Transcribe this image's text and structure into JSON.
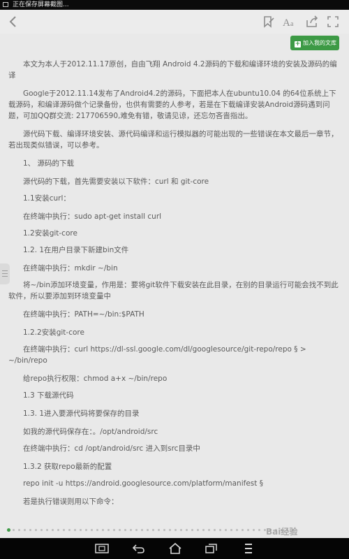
{
  "status_bar": {
    "text": "正在保存屏幕截图..."
  },
  "toolbar": {
    "back_icon": "back-chevron-icon",
    "tools": [
      "bookmark-edit-icon",
      "font-size-icon",
      "share-icon",
      "fullscreen-icon"
    ]
  },
  "add_library_button": {
    "label": "加入我的文库"
  },
  "article": {
    "paragraphs": [
      {
        "text": "本文为本人于2012.11.17原创，自由飞翔 Android 4.2源码的下载和编译环境的安装及源码的编译",
        "indent": true
      },
      {
        "text": "Google于2012.11.14发布了Android4.2的源码，下面把本人在ubuntu10.04 的64位系统上下载源码，和编译源码做个记录备份，也供有需要的人参考，若是在下载编译安装Android源码遇到问题，可加QQ群交流: 217706590,难免有错，敬请见谅，还忘勿吝啬指出。",
        "indent": true
      },
      {
        "text": "源代码下载、编译环境安装、源代码编译和运行模拟器的可能出现的一些错误在本文最后一章节，若出现类似错误，可以参考。",
        "indent": true
      },
      {
        "text": "1、 源码的下载",
        "indent": true
      },
      {
        "text": "源代码的下载，首先需要安装以下软件：curl 和 git-core",
        "indent": true
      },
      {
        "text": "1.1安装curl：",
        "indent": true
      },
      {
        "text": "在终端中执行：sudo apt-get install curl",
        "indent": true
      },
      {
        "text": "1.2安装git-core",
        "indent": true
      },
      {
        "text": "1.2. 1在用户目录下新建bin文件",
        "indent": true
      },
      {
        "text": "在终端中执行：mkdir ~/bin",
        "indent": true
      },
      {
        "text": "将~/bin添加环境变量，作用是：要将git软件下载安装在此目录，在别的目录运行可能会找不到此软件，所以要添加到环境变量中",
        "indent": true
      },
      {
        "text": "在终端中执行：PATH=~/bin:$PATH",
        "indent": true
      },
      {
        "text": "1.2.2安装git-core",
        "indent": true
      },
      {
        "text": "在终端中执行：curl https://dl-ssl.google.com/dl/googlesource/git-repo/repo § > ~/bin/repo",
        "indent": true
      },
      {
        "text": "给repo执行权限：chmod a+x ~/bin/repo",
        "indent": true
      },
      {
        "text": "1.3 下载源代码",
        "indent": true
      },
      {
        "text": "1.3. 1进入要源代码将要保存的目录",
        "indent": true
      },
      {
        "text": "如我的源代码保存在：。/opt/android/src",
        "indent": true
      },
      {
        "text": "在终端中执行：cd /opt/android/src 进入到src目录中",
        "indent": true
      },
      {
        "text": "1.3.2 获取repo最新的配置",
        "indent": true
      },
      {
        "text": "repo init -u https://android.googlesource.com/platform/manifest §",
        "indent": true
      },
      {
        "text": "若是执行错误则用以下命令：",
        "indent": true
      }
    ]
  },
  "page_indicator": {
    "active_index": 0,
    "count": 52
  },
  "watermark": {
    "text": "Bai经验"
  },
  "nav_bar": {
    "buttons": [
      "screenshot-icon",
      "back-icon",
      "home-icon",
      "recent-apps-icon",
      "menu-icon"
    ]
  }
}
